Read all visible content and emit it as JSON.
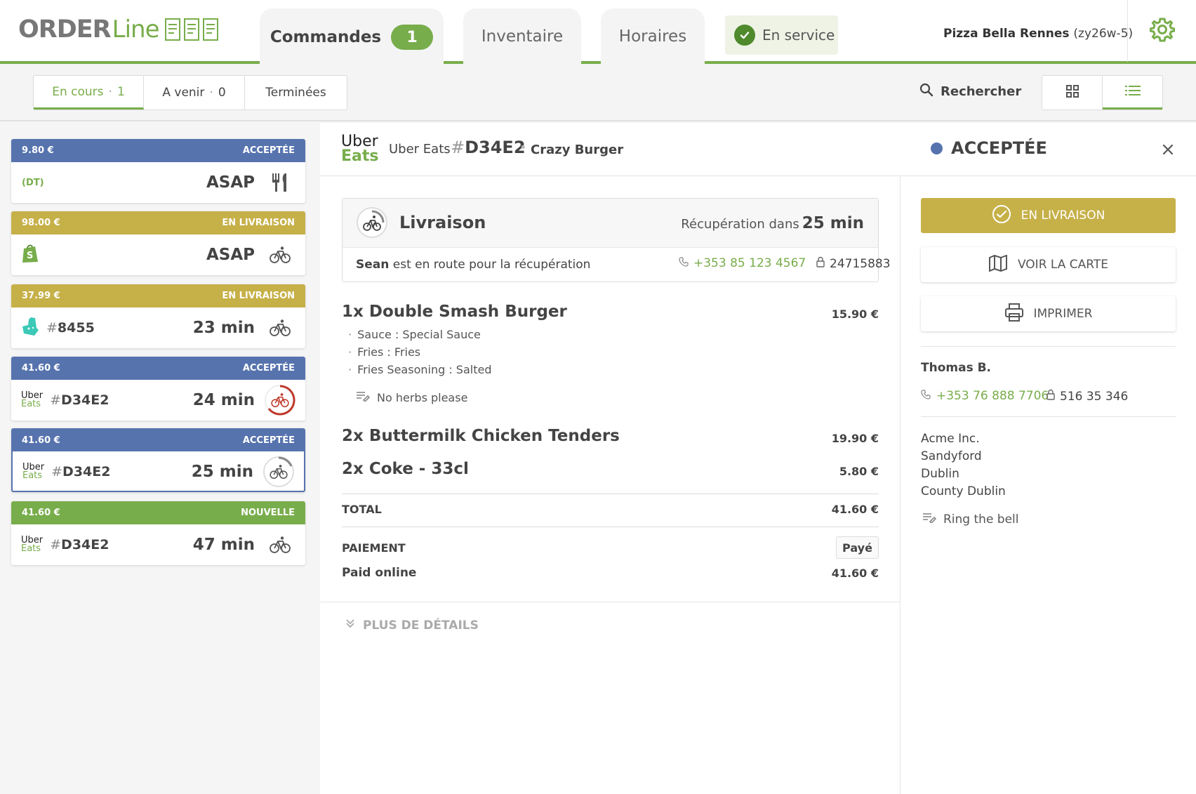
{
  "brand": {
    "order": "ORDER",
    "line": "Line"
  },
  "tabs": {
    "commandes": "Commandes",
    "commandes_count": "1",
    "inventaire": "Inventaire",
    "horaires": "Horaires"
  },
  "service_status": "En service",
  "store": {
    "name": "Pizza Bella Rennes",
    "code": "(zy26w-5)"
  },
  "segments": {
    "en_cours": "En cours",
    "en_cours_count": "1",
    "a_venir": "A venir",
    "a_venir_count": "0",
    "terminees": "Terminées",
    "separator": "·"
  },
  "search_label": "Rechercher",
  "colors": {
    "green": "#78ad4b",
    "blue": "#5673ae",
    "gold": "#c6b048",
    "red": "#c0392b"
  },
  "orders": [
    {
      "price": "9.80 €",
      "status": "ACCEPTÉE",
      "color": "#5673ae",
      "source": "none",
      "ref": "",
      "extra": "(DT)",
      "time": "ASAP",
      "mode": "fork-knife-icon"
    },
    {
      "price": "98.00 €",
      "status": "EN LIVRAISON",
      "color": "#c6b048",
      "source": "shopify",
      "ref": "",
      "extra": "",
      "time": "ASAP",
      "mode": "bike-icon"
    },
    {
      "price": "37.99 €",
      "status": "EN LIVRAISON",
      "color": "#c6b048",
      "source": "deliveroo",
      "ref": "8455",
      "extra": "",
      "time": "23 min",
      "mode": "bike-icon"
    },
    {
      "price": "41.60 €",
      "status": "ACCEPTÉE",
      "color": "#5673ae",
      "source": "ubereats",
      "ref": "D34E2",
      "extra": "",
      "time": "24 min",
      "mode": "bike-timer-red-icon"
    },
    {
      "price": "41.60 €",
      "status": "ACCEPTÉE",
      "color": "#5673ae",
      "source": "ubereats",
      "ref": "D34E2",
      "extra": "",
      "time": "25 min",
      "mode": "bike-timer-icon"
    },
    {
      "price": "41.60 €",
      "status": "NOUVELLE",
      "color": "#78ad4b",
      "source": "ubereats",
      "ref": "D34E2",
      "extra": "",
      "time": "47 min",
      "mode": "bike-icon"
    }
  ],
  "uber": {
    "u": "Uber",
    "e": "Eats"
  },
  "hash": "#",
  "detail": {
    "platform": "Uber Eats",
    "ref": "D34E2",
    "dot": "•",
    "store": "Crazy Burger",
    "status": "ACCEPTÉE",
    "delivery": {
      "title": "Livraison",
      "pickup_label": "Récupération dans",
      "pickup_time": "25 min",
      "driver_name": "Sean",
      "driver_text": " est en route pour la récupération",
      "phone": "+353 85 123 4567",
      "code": "24715883"
    },
    "items": [
      {
        "name": "1x Double Smash Burger",
        "price": "15.90 €"
      },
      {
        "name": "2x Buttermilk Chicken Tenders",
        "price": "19.90 €"
      },
      {
        "name": "2x Coke - 33cl",
        "price": "5.80 €"
      }
    ],
    "options": [
      "Sauce : Special Sauce",
      "Fries : Fries",
      "Fries Seasoning : Salted"
    ],
    "item_note": "No herbs please",
    "total_label": "TOTAL",
    "total_value": "41.60 €",
    "payment_label": "PAIEMENT",
    "payment_status": "Payé",
    "payment_method": "Paid online",
    "payment_value": "41.60 €",
    "more_label": "PLUS DE DÉTAILS"
  },
  "actions": {
    "primary": "EN LIVRAISON",
    "map": "VOIR LA CARTE",
    "print": "IMPRIMER"
  },
  "customer": {
    "name": "Thomas B.",
    "phone": "+353 76 888 7706",
    "code": "516 35 346",
    "address": [
      "Acme Inc.",
      "Sandyford",
      "Dublin",
      "County Dublin"
    ],
    "note": "Ring the bell"
  }
}
